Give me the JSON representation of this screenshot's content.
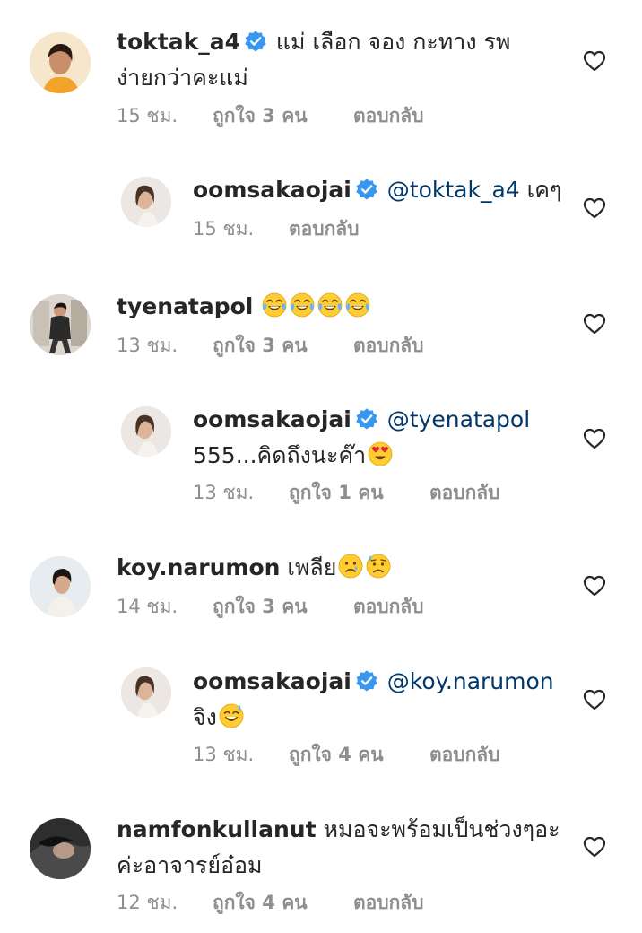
{
  "comments": [
    {
      "username": "toktak_a4",
      "verified": true,
      "text_line1": "แม่ เลือก จอง กะทาง รพ",
      "text_line2": "ง่ายกว่าคะแม่",
      "time": "15 ชม.",
      "likes": "ถูกใจ 3 คน",
      "reply_label": "ตอบกลับ",
      "avatar_bg": "#f0c060"
    },
    {
      "username": "oomsakaojai",
      "verified": true,
      "mention": "@toktak_a4",
      "text": "เคๆ",
      "time": "15 ชม.",
      "reply_label": "ตอบกลับ",
      "avatar_bg": "#e9e4df"
    },
    {
      "username": "tyenatapol",
      "verified": false,
      "emojis": [
        "tears-of-joy-emoji",
        "tears-of-joy-emoji",
        "tears-of-joy-emoji",
        "tears-of-joy-emoji"
      ],
      "time": "13 ชม.",
      "likes": "ถูกใจ 3 คน",
      "reply_label": "ตอบกลับ",
      "avatar_bg": "#d8d2cb"
    },
    {
      "username": "oomsakaojai",
      "verified": true,
      "mention": "@tyenatapol",
      "text_line2": "555...คิดถึงนะค๊า",
      "emoji": "heart-eyes-emoji",
      "time": "13 ชม.",
      "likes": "ถูกใจ 1 คน",
      "reply_label": "ตอบกลับ",
      "avatar_bg": "#e9e4df"
    },
    {
      "username": "koy.narumon",
      "verified": false,
      "text": "เพลีย",
      "emojis": [
        "crying-face-emoji",
        "sad-sweat-face-emoji"
      ],
      "time": "14 ชม.",
      "likes": "ถูกใจ 3 คน",
      "reply_label": "ตอบกลับ",
      "avatar_bg": "#dfe6ea"
    },
    {
      "username": "oomsakaojai",
      "verified": true,
      "mention": "@koy.narumon",
      "text_line2": "จิง",
      "emoji": "grinning-sweat-emoji",
      "time": "13 ชม.",
      "likes": "ถูกใจ 4 คน",
      "reply_label": "ตอบกลับ",
      "avatar_bg": "#e9e4df"
    },
    {
      "username": "namfonkullanut",
      "verified": false,
      "text_line1": "หมอจะพร้อมเป็นช่วงๆอะ",
      "text_line2": "ค่ะอาจารย์อ๋อม",
      "time": "12 ชม.",
      "likes": "ถูกใจ 4 คน",
      "reply_label": "ตอบกลับ",
      "avatar_bg": "#3a3a3a"
    }
  ],
  "colors": {
    "text": "#262626",
    "meta": "#8e8e8e",
    "mention": "#00376b",
    "verified": "#3897f0"
  }
}
